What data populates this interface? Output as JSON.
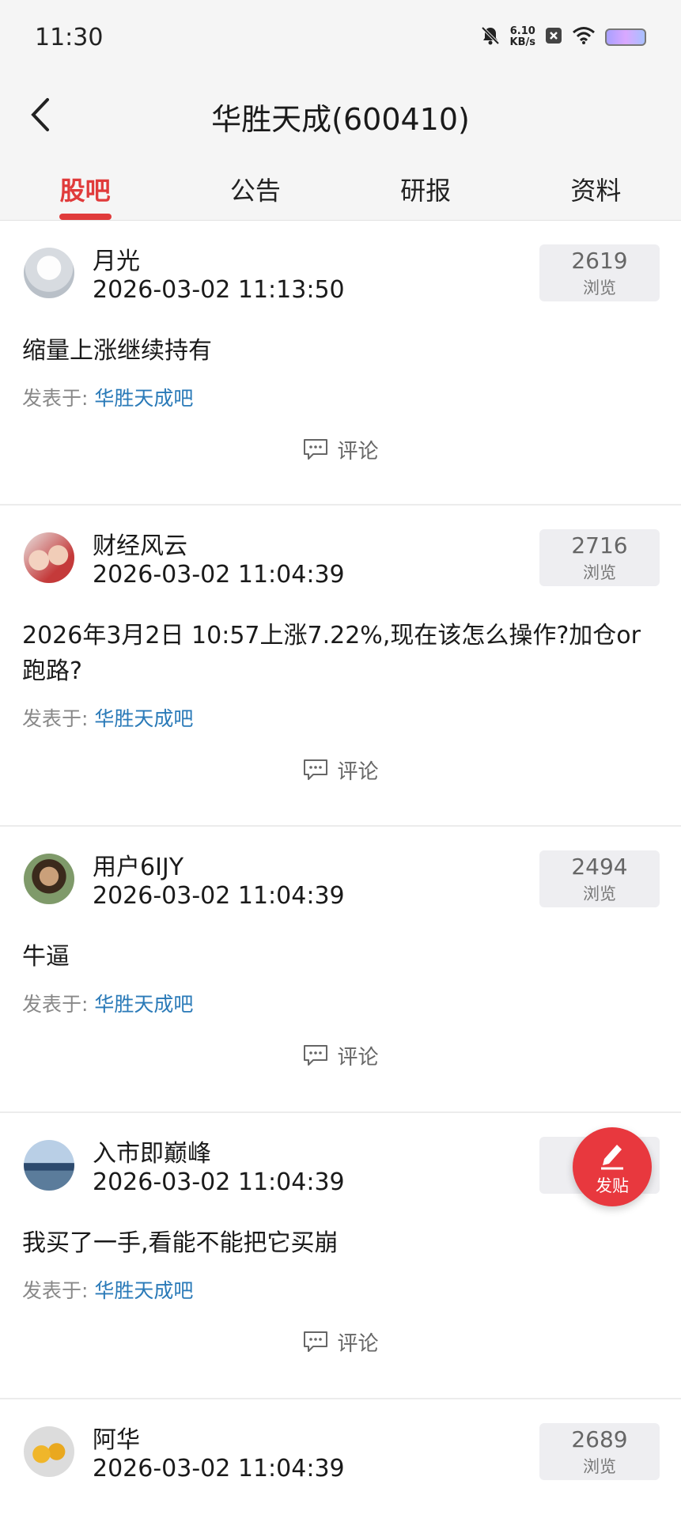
{
  "status_bar": {
    "time": "11:30",
    "net_speed_value": "6.10",
    "net_speed_unit": "KB/s",
    "icons": [
      "mute-bell-icon",
      "x-box-icon",
      "wifi-icon",
      "battery-icon"
    ]
  },
  "header": {
    "title": "华胜天成(600410)",
    "back_icon": "chevron-left-icon"
  },
  "tabs": [
    {
      "label": "股吧",
      "active": true
    },
    {
      "label": "公告",
      "active": false
    },
    {
      "label": "研报",
      "active": false
    },
    {
      "label": "资料",
      "active": false
    }
  ],
  "colors": {
    "accent": "#e03b3b",
    "link": "#2a7ab8",
    "fab": "#e8383e"
  },
  "posts": [
    {
      "username": "月光",
      "timestamp": "2026-03-02 11:13:50",
      "views": "2619",
      "views_label": "浏览",
      "content": "缩量上涨继续持有",
      "posted_in_label": "发表于:",
      "forum": "华胜天成吧",
      "comment_label": "评论"
    },
    {
      "username": "财经风云",
      "timestamp": "2026-03-02 11:04:39",
      "views": "2716",
      "views_label": "浏览",
      "content": "2026年3月2日 10:57上涨7.22%,现在该怎么操作?加仓or跑路?",
      "posted_in_label": "发表于:",
      "forum": "华胜天成吧",
      "comment_label": "评论"
    },
    {
      "username": "用户6IJY",
      "timestamp": "2026-03-02 11:04:39",
      "views": "2494",
      "views_label": "浏览",
      "content": "牛逼",
      "posted_in_label": "发表于:",
      "forum": "华胜天成吧",
      "comment_label": "评论"
    },
    {
      "username": "入市即巅峰",
      "timestamp": "2026-03-02 11:04:39",
      "views": "",
      "views_label": "",
      "content": "我买了一手,看能不能把它买崩",
      "posted_in_label": "发表于:",
      "forum": "华胜天成吧",
      "comment_label": "评论"
    },
    {
      "username": "阿华",
      "timestamp": "2026-03-02 11:04:39",
      "views": "2689",
      "views_label": "浏览",
      "content": "",
      "posted_in_label": "",
      "forum": "",
      "comment_label": ""
    }
  ],
  "fab": {
    "label": "发贴",
    "icon": "pencil-icon"
  }
}
